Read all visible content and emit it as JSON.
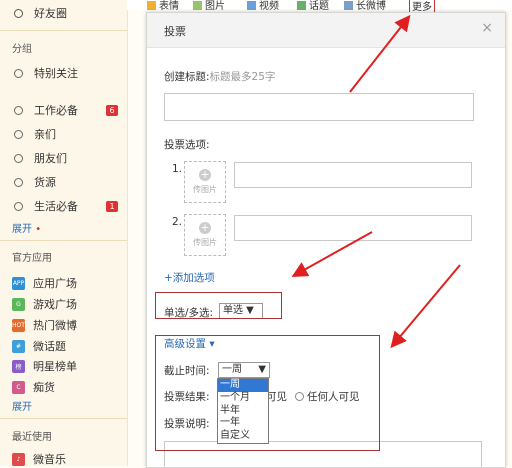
{
  "sidebar": {
    "top_item": "好友圈",
    "group_title": "分组",
    "special": "特别关注",
    "groups": [
      {
        "label": "工作必备",
        "badge": "6"
      },
      {
        "label": "亲们",
        "badge": ""
      },
      {
        "label": "朋友们",
        "badge": ""
      },
      {
        "label": "货源",
        "badge": ""
      },
      {
        "label": "生活必备",
        "badge": "1"
      }
    ],
    "expand1": "展开",
    "apps_title": "官方应用",
    "apps": [
      {
        "label": "应用广场",
        "color": "#2f8fd8",
        "icon": "APP"
      },
      {
        "label": "游戏广场",
        "color": "#5ab85a",
        "icon": "G"
      },
      {
        "label": "热门微博",
        "color": "#e36b2c",
        "icon": "HOT"
      },
      {
        "label": "微话题",
        "color": "#3fa0d9",
        "icon": "#"
      },
      {
        "label": "明星榜单",
        "color": "#8a5cc7",
        "icon": "榜"
      },
      {
        "label": "痴货",
        "color": "#d35a8c",
        "icon": "C"
      }
    ],
    "expand2": "展开",
    "recent_title": "最近使用",
    "recent_item": "微音乐"
  },
  "topbar": [
    "表情",
    "图片",
    "视频",
    "话题",
    "长微博",
    "更多"
  ],
  "dialog": {
    "title": "投票",
    "close": "×",
    "create_label": "创建标题:",
    "create_hint": "标题最多25字",
    "options_label": "投票选项:",
    "option_numbers": [
      "1.",
      "2."
    ],
    "upload_text": "传图片",
    "add_option": "+添加选项",
    "single_multi_label": "单选/多选:",
    "single_multi_value": "单选 ▼",
    "advanced": "高级设置 ▾",
    "deadline_label": "截止时间:",
    "deadline_value": "一周",
    "dropdown_options": [
      "一周",
      "一个月",
      "半年",
      "一年",
      "自定义"
    ],
    "result_label": "投票结果:",
    "result_visible": "可见",
    "result_anyone": "任何人可见",
    "desc_label": "投票说明:"
  }
}
